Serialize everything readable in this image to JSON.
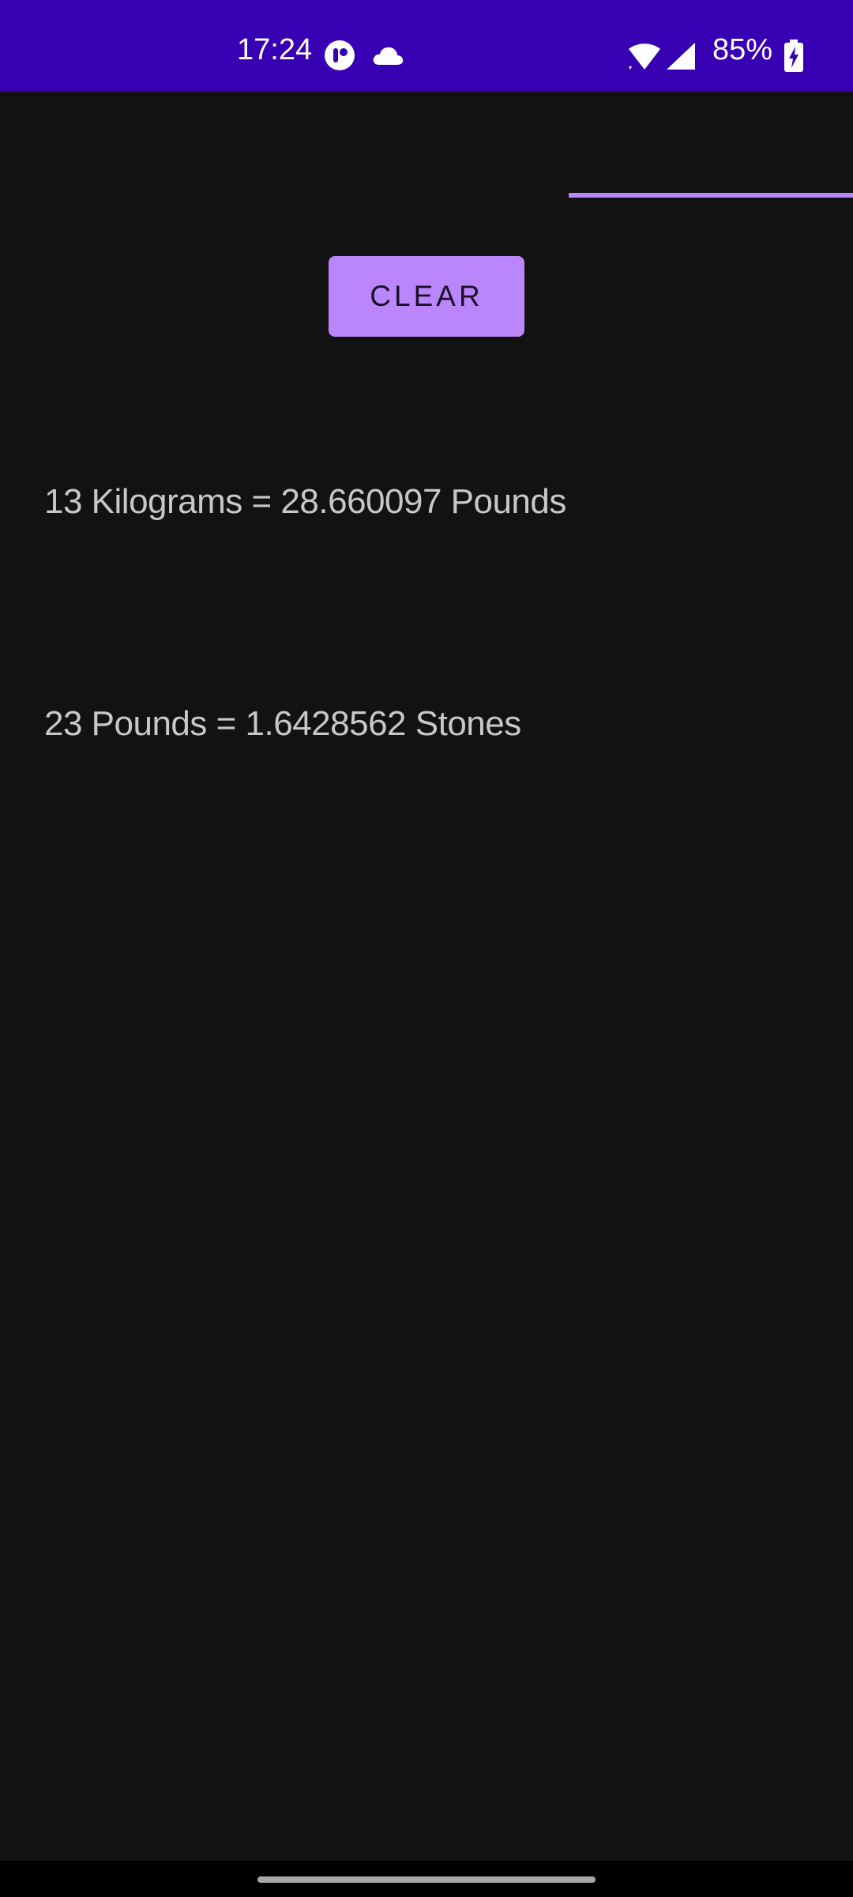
{
  "status_bar": {
    "time": "17:24",
    "battery": "85%",
    "icons": [
      "app-notification-icon",
      "cloud-icon",
      "wifi-icon",
      "cell-signal-icon",
      "battery-charging-icon"
    ]
  },
  "colors": {
    "status_bar": "#3700b3",
    "background": "#121212",
    "accent": "#bb86fc",
    "text": "#c8c8c8"
  },
  "main": {
    "clear_label": "CLEAR",
    "results": [
      "13 Kilograms = 28.660097 Pounds",
      "23 Pounds = 1.6428562 Stones"
    ]
  }
}
